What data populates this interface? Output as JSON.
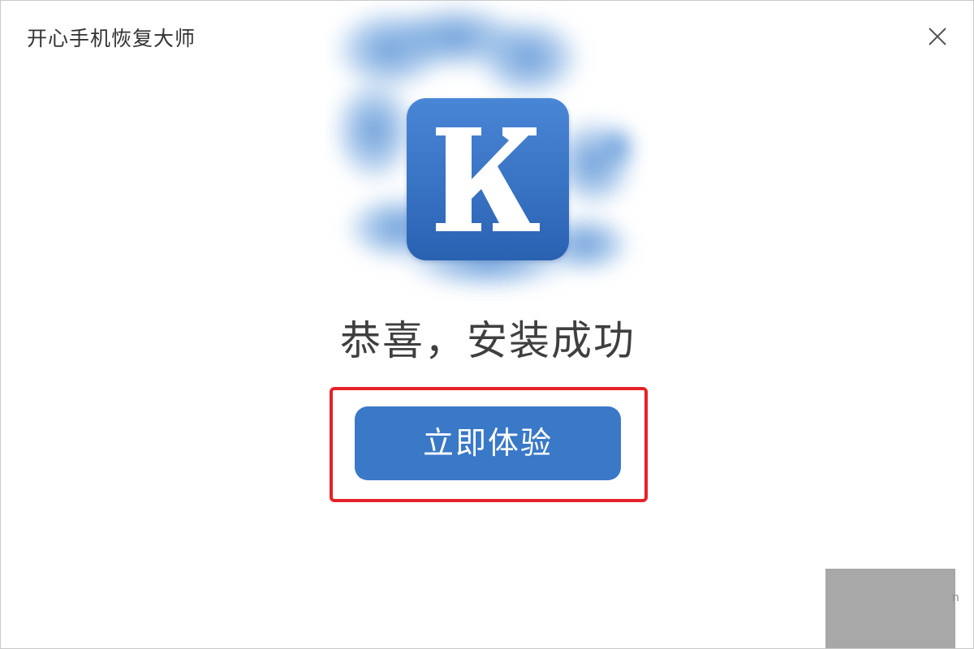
{
  "window": {
    "title": "开心手机恢复大师"
  },
  "icons": {
    "close": "close-icon",
    "app": "app-logo-k-icon"
  },
  "main": {
    "headline": "恭喜，安装成功",
    "cta_label": "立即体验"
  },
  "colors": {
    "accent": "#3a78c8",
    "highlight_border": "#e5232b",
    "logo_gradient_top": "#4a86d6",
    "logo_gradient_bottom": "#2a62b2",
    "text": "#3f3f3f"
  },
  "watermark": {
    "text": "n"
  }
}
